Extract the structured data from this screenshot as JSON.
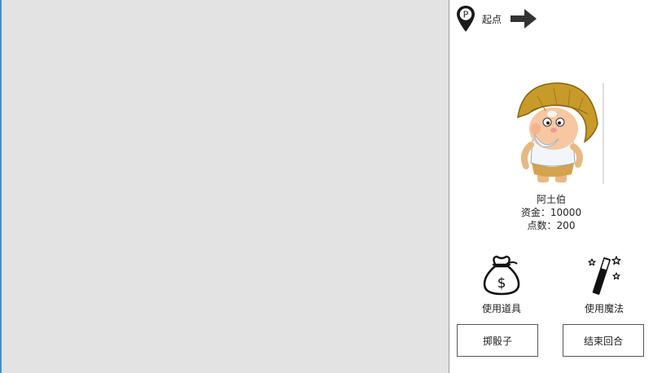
{
  "location": {
    "label": "起点",
    "pin_icon": "location-pin-icon",
    "arrow_icon": "arrow-right-icon"
  },
  "player": {
    "name": "阿土伯",
    "money": "资金：10000",
    "points": "点数：200"
  },
  "actions": {
    "use_item": {
      "label": "使用道具",
      "icon": "money-bag-icon"
    },
    "use_magic": {
      "label": "使用魔法",
      "icon": "magic-wand-icon"
    }
  },
  "buttons": {
    "roll_dice": "掷骰子",
    "end_turn": "结束回合"
  },
  "colors": {
    "board_bg": "#e3e3e3",
    "board_border": "#4a90c8",
    "hat": "#c89a2a"
  }
}
